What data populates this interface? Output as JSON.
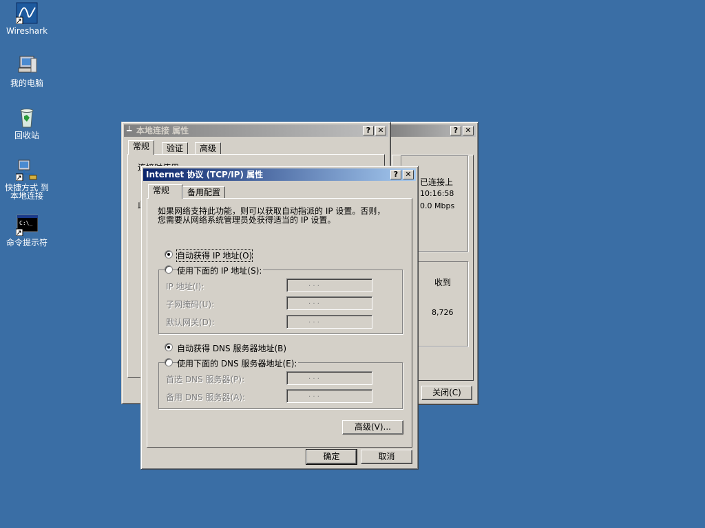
{
  "desktop": {
    "icons": [
      {
        "label": "Wireshark"
      },
      {
        "label": "我的电脑"
      },
      {
        "label": "回收站"
      },
      {
        "label": "快捷方式 到\n本地连接"
      },
      {
        "label": "命令提示符"
      }
    ]
  },
  "status_window": {
    "help": "?",
    "close": "✕",
    "connected_text": "已连接上",
    "duration": "10:16:58",
    "speed": "0.0 Mbps",
    "received_label": "收到",
    "received_value": "8,726",
    "close_button": "关闭(C)"
  },
  "props_window": {
    "title": "本地连接 属性",
    "help": "?",
    "close": "✕",
    "tabs": [
      "常规",
      "验证",
      "高级"
    ],
    "connect_using_partial": "连接时使用:",
    "partial_char": "此"
  },
  "tcpip_dialog": {
    "title": "Internet 协议 (TCP/IP) 属性",
    "help": "?",
    "close": "✕",
    "tabs": [
      "常规",
      "备用配置"
    ],
    "description": "如果网络支持此功能，则可以获取自动指派的 IP 设置。否则，\n您需要从网络系统管理员处获得适当的 IP 设置。",
    "auto_ip": "自动获得 IP 地址(O)",
    "manual_ip": "使用下面的 IP 地址(S):",
    "ip_address_label": "IP 地址(I):",
    "subnet_label": "子网掩码(U):",
    "gateway_label": "默认网关(D):",
    "auto_dns": "自动获得 DNS 服务器地址(B)",
    "manual_dns": "使用下面的 DNS 服务器地址(E):",
    "preferred_dns_label": "首选 DNS 服务器(P):",
    "alternate_dns_label": "备用 DNS 服务器(A):",
    "advanced_button": "高级(V)...",
    "ok_button": "确定",
    "cancel_button": "取消",
    "ip_dots": ".      .      .",
    "ip_selected": "auto",
    "dns_selected": "auto"
  }
}
